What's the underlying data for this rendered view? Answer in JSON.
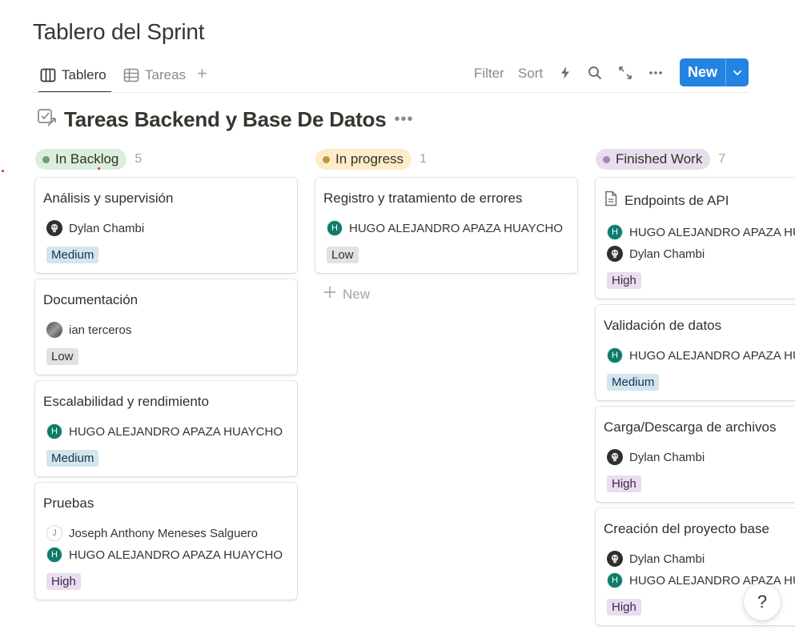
{
  "page": {
    "title": "Tablero del Sprint"
  },
  "views": {
    "tabs": [
      {
        "label": "Tablero",
        "icon": "board-icon",
        "active": true
      },
      {
        "label": "Tareas",
        "icon": "table-icon",
        "active": false
      }
    ],
    "add_view_icon": "plus-icon"
  },
  "toolbar": {
    "filter_label": "Filter",
    "sort_label": "Sort",
    "icons": [
      "lightning-icon",
      "search-icon",
      "expand-icon",
      "more-icon"
    ],
    "new_label": "New",
    "new_accent": "#2383e2"
  },
  "database": {
    "title": "Tareas Backend y Base De Datos",
    "icon": "linked-database-icon",
    "more_label": "•••"
  },
  "board": {
    "add_new_label": "New",
    "columns": [
      {
        "name": "In Backlog",
        "count": "5",
        "pill_color": "#dbeddb",
        "dot_color": "#6c9b7d",
        "cards": [
          {
            "title": "Análisis y supervisión",
            "people": [
              {
                "name": "Dylan Chambi",
                "avatar": "d"
              }
            ],
            "priority": "Medium"
          },
          {
            "title": "Documentación",
            "people": [
              {
                "name": "ian terceros",
                "avatar": "i"
              }
            ],
            "priority": "Low"
          },
          {
            "title": "Escalabilidad y rendimiento",
            "people": [
              {
                "name": "HUGO ALEJANDRO APAZA HUAYCHO",
                "avatar": "h",
                "initial": "H"
              }
            ],
            "priority": "Medium"
          },
          {
            "title": "Pruebas",
            "people": [
              {
                "name": "Joseph Anthony Meneses Salguero",
                "avatar": "j",
                "initial": "J"
              },
              {
                "name": "HUGO ALEJANDRO APAZA HUAYCHO",
                "avatar": "h",
                "initial": "H"
              }
            ],
            "priority": "High"
          }
        ]
      },
      {
        "name": "In progress",
        "count": "1",
        "pill_color": "#fdecc8",
        "dot_color": "#c29343",
        "cards": [
          {
            "title": "Registro y tratamiento de errores",
            "people": [
              {
                "name": "HUGO ALEJANDRO APAZA HUAYCHO",
                "avatar": "h",
                "initial": "H"
              }
            ],
            "priority": "Low"
          }
        ]
      },
      {
        "name": "Finished Work",
        "count": "7",
        "pill_color": "#e8deee",
        "dot_color": "#a782c3",
        "cards": [
          {
            "title": "Endpoints de API",
            "doc_icon": true,
            "people": [
              {
                "name": "HUGO ALEJANDRO APAZA HUAYCHO",
                "avatar": "h",
                "initial": "H"
              },
              {
                "name": "Dylan Chambi",
                "avatar": "d"
              }
            ],
            "priority": "High"
          },
          {
            "title": "Validación de datos",
            "people": [
              {
                "name": "HUGO ALEJANDRO APAZA HUAYCHO",
                "avatar": "h",
                "initial": "H"
              }
            ],
            "priority": "Medium"
          },
          {
            "title": "Carga/Descarga de archivos",
            "people": [
              {
                "name": "Dylan Chambi",
                "avatar": "d"
              }
            ],
            "priority": "High"
          },
          {
            "title": "Creación del proyecto base",
            "people": [
              {
                "name": "Dylan Chambi",
                "avatar": "d"
              },
              {
                "name": "HUGO ALEJANDRO APAZA HUAYCHO",
                "avatar": "h",
                "initial": "H"
              }
            ],
            "priority": "High"
          }
        ]
      }
    ]
  },
  "help": {
    "label": "?"
  }
}
